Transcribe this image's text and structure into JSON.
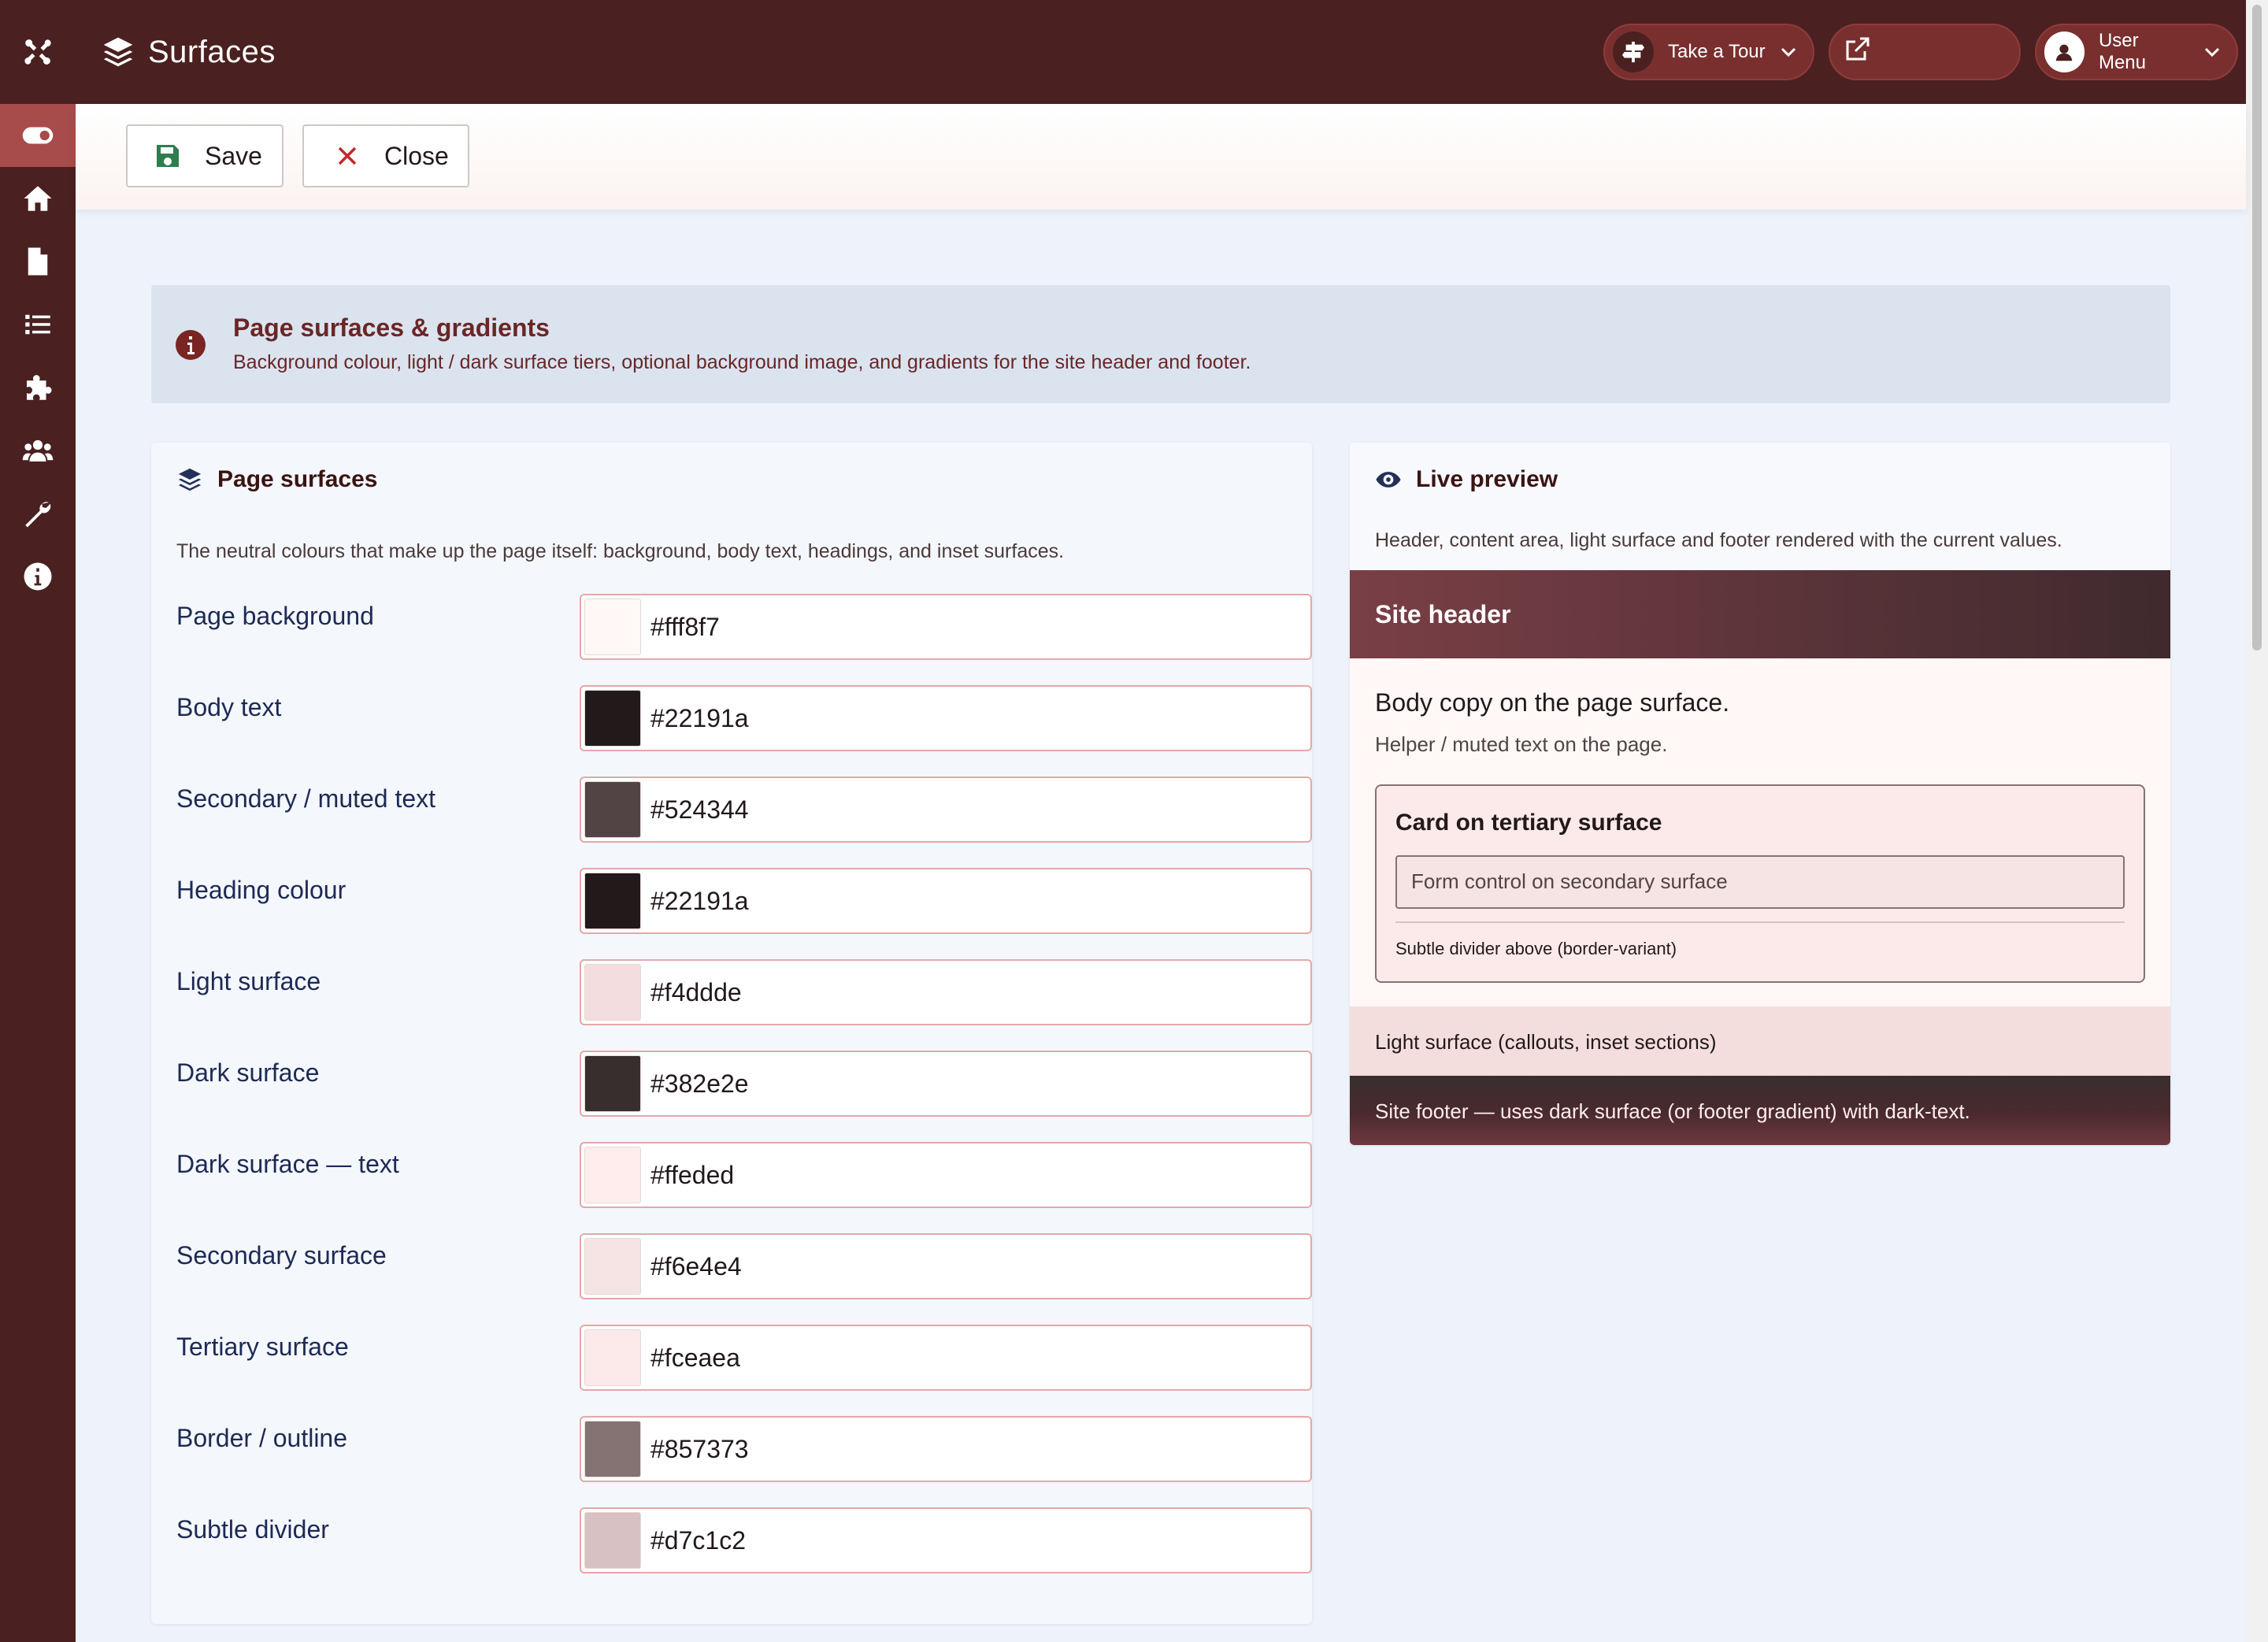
{
  "header": {
    "title": "Surfaces",
    "tour_label": "Take a Tour",
    "site_label": "",
    "user_label": "User Menu"
  },
  "toolbar": {
    "save_label": "Save",
    "close_label": "Close"
  },
  "alert": {
    "title": "Page surfaces & gradients",
    "body": "Background colour, light / dark surface tiers, optional background image, and gradients for the site header and footer."
  },
  "surfaces": {
    "heading": "Page surfaces",
    "description": "The neutral colours that make up the page itself: background, body text, headings, and inset surfaces.",
    "fields": [
      {
        "label": "Page background",
        "value": "#fff8f7"
      },
      {
        "label": "Body text",
        "value": "#22191a"
      },
      {
        "label": "Secondary / muted text",
        "value": "#524344"
      },
      {
        "label": "Heading colour",
        "value": "#22191a"
      },
      {
        "label": "Light surface",
        "value": "#f4ddde"
      },
      {
        "label": "Dark surface",
        "value": "#382e2e"
      },
      {
        "label": "Dark surface — text",
        "value": "#ffeded"
      },
      {
        "label": "Secondary surface",
        "value": "#f6e4e4"
      },
      {
        "label": "Tertiary surface",
        "value": "#fceaea"
      },
      {
        "label": "Border / outline",
        "value": "#857373"
      },
      {
        "label": "Subtle divider",
        "value": "#d7c1c2"
      }
    ]
  },
  "preview": {
    "heading": "Live preview",
    "description": "Header, content area, light surface and footer rendered with the current values.",
    "site_header": "Site header",
    "body_copy": "Body copy on the page surface.",
    "helper_text": "Helper / muted text on the page.",
    "card_title": "Card on tertiary surface",
    "form_control": "Form control on secondary surface",
    "divider_text": "Subtle divider above (border-variant)",
    "light_surface": "Light surface (callouts, inset sections)",
    "footer": "Site footer — uses dark surface (or footer gradient) with dark-text."
  },
  "sidebar": {
    "items": [
      "toggle-icon",
      "home-icon",
      "article-icon",
      "list-icon",
      "puzzle-icon",
      "users-icon",
      "wrench-icon",
      "info-icon"
    ]
  },
  "colors": {
    "brand": "#4a2020",
    "accent": "#a84b4b",
    "background": "#eef3fb"
  }
}
